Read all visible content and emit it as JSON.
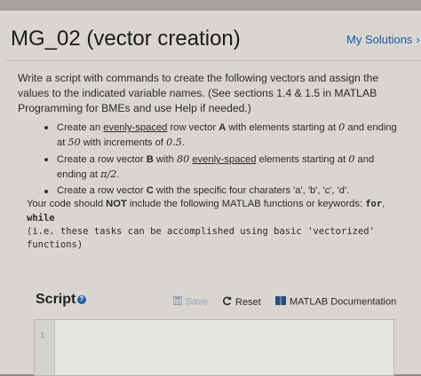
{
  "title": "MG_02 (vector creation)",
  "my_solutions": "My Solutions",
  "my_solutions_chevron": "›",
  "instructions": "Write a script with commands to create the following vectors and assign the values to the indicated variable names. (See sections 1.4 & 1.5 in MATLAB Programming for BMEs and use Help if needed.)",
  "bullets": [
    {
      "a": "Create an ",
      "link": "evenly-spaced",
      "b": " row vector ",
      "var": "A",
      "c": " with elements starting at ",
      "m1": "0",
      "d": " and ending at ",
      "m2": "50",
      "e": " with increments of ",
      "m3": "0.5",
      "f": "."
    },
    {
      "a": "Create a row vector ",
      "var": "B",
      "b": " with ",
      "m1": "80",
      "c": " ",
      "link": "evenly-spaced",
      "d": " elements starting at ",
      "m2": "0",
      "e": " and ending at ",
      "m3": "π/2",
      "f": "."
    },
    {
      "a": "Create a row vector ",
      "var": "C",
      "b": " with the specific four charaters 'a', 'b', 'c', 'd'."
    }
  ],
  "note": {
    "a": "Your code should ",
    "not": "NOT",
    "b": " include the following MATLAB functions or keywords: ",
    "k1": "for",
    "c": ", ",
    "k2": "while",
    "code": "(i.e. these tasks can be accomplished using basic 'vectorized' functions)"
  },
  "script": {
    "label": "Script",
    "help_glyph": "?",
    "save": "Save",
    "reset": "Reset",
    "doc": "MATLAB Documentation",
    "line_number": "1"
  },
  "colors": {
    "link": "#1f58a7",
    "help": "#225ea8",
    "muted": "#9aa4ad"
  }
}
